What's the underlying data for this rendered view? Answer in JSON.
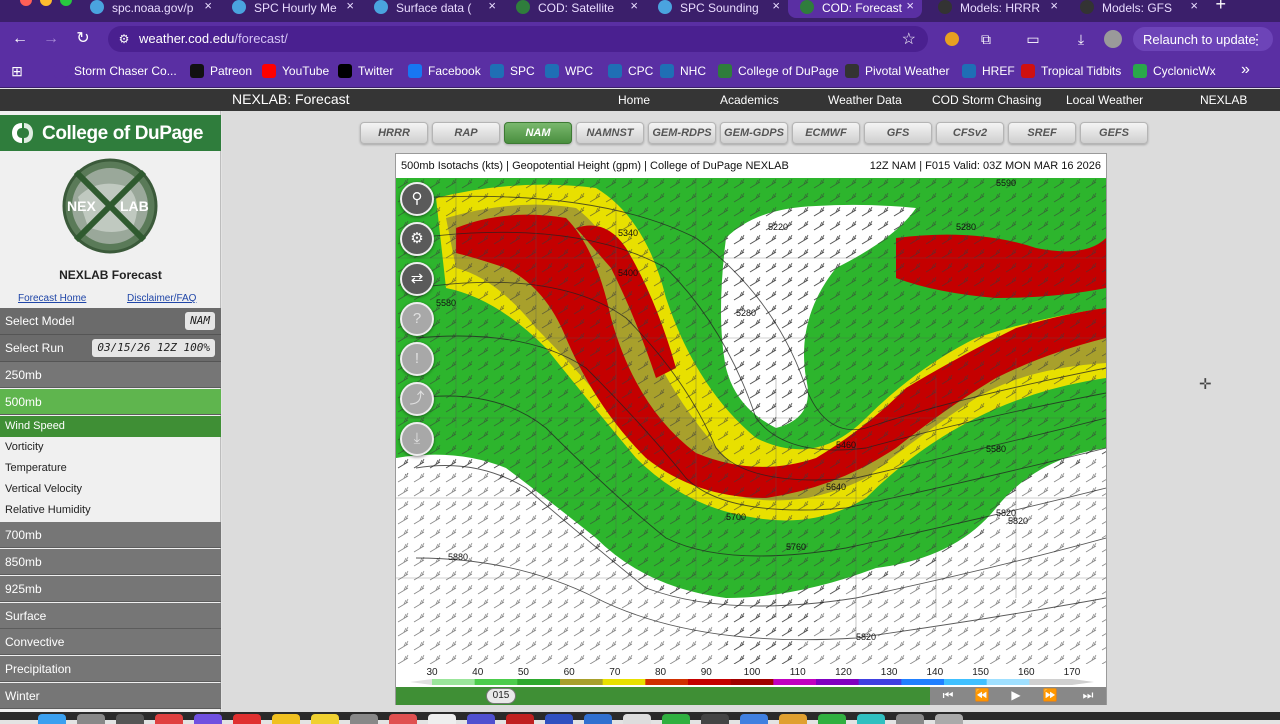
{
  "browser": {
    "tabs": [
      {
        "title": "spc.noaa.gov/p",
        "active": false
      },
      {
        "title": "SPC Hourly Me",
        "active": false
      },
      {
        "title": "Surface data (",
        "active": false
      },
      {
        "title": "COD: Satellite",
        "active": false
      },
      {
        "title": "SPC Sounding",
        "active": false
      },
      {
        "title": "COD: Forecast",
        "active": true
      },
      {
        "title": "Models: HRRR",
        "active": false
      },
      {
        "title": "Models: GFS",
        "active": false
      }
    ],
    "new_tab_symbol": "+",
    "url_host": "weather.cod.edu",
    "url_path": "/forecast/",
    "relaunch_label": "Relaunch to update",
    "bookmarks": [
      {
        "label": "Storm Chaser Co...",
        "icon": "folder-icon",
        "color": "#5a2fa3"
      },
      {
        "label": "Patreon",
        "icon": "patreon-icon",
        "color": "#111111"
      },
      {
        "label": "YouTube",
        "icon": "youtube-icon",
        "color": "#ff0000"
      },
      {
        "label": "Twitter",
        "icon": "x-icon",
        "color": "#000000"
      },
      {
        "label": "Facebook",
        "icon": "facebook-icon",
        "color": "#1877f2"
      },
      {
        "label": "SPC",
        "icon": "noaa-icon",
        "color": "#1f6fb5"
      },
      {
        "label": "WPC",
        "icon": "noaa-icon",
        "color": "#1f6fb5"
      },
      {
        "label": "CPC",
        "icon": "noaa-icon",
        "color": "#1f6fb5"
      },
      {
        "label": "NHC",
        "icon": "noaa-icon",
        "color": "#1f6fb5"
      },
      {
        "label": "College of DuPage",
        "icon": "cod-icon",
        "color": "#2f7d3c"
      },
      {
        "label": "Pivotal Weather",
        "icon": "pivotal-icon",
        "color": "#333333"
      },
      {
        "label": "HREF",
        "icon": "noaa-icon",
        "color": "#1f6fb5"
      },
      {
        "label": "Tropical Tidbits",
        "icon": "tropical-icon",
        "color": "#d01010"
      },
      {
        "label": "CyclonicWx",
        "icon": "cyclonic-icon",
        "color": "#2aa84a"
      }
    ],
    "more_bookmarks_symbol": "»"
  },
  "site": {
    "title": "NEXLAB: Forecast",
    "nav": [
      "Home",
      "Academics",
      "Weather Data",
      "COD Storm Chasing",
      "Local Weather",
      "NEXLAB"
    ]
  },
  "sidebar": {
    "college_name": "College of DuPage",
    "nexlab_logo_text": [
      "NEX",
      "LAB"
    ],
    "forecast_title": "NEXLAB Forecast",
    "links": [
      "Forecast Home",
      "Disclaimer/FAQ"
    ],
    "select_model": {
      "label": "Select Model",
      "value": "NAM"
    },
    "select_run": {
      "label": "Select Run",
      "value": "03/15/26 12Z 100%"
    },
    "levels_top": [
      {
        "label": "250mb",
        "active": false
      },
      {
        "label": "500mb",
        "active": true
      }
    ],
    "fields": [
      {
        "label": "Wind Speed",
        "active": true
      },
      {
        "label": "Vorticity",
        "active": false
      },
      {
        "label": "Temperature",
        "active": false
      },
      {
        "label": "Vertical Velocity",
        "active": false
      },
      {
        "label": "Relative Humidity",
        "active": false
      }
    ],
    "levels_bottom": [
      "700mb",
      "850mb",
      "925mb",
      "Surface",
      "Convective",
      "Precipitation",
      "Winter"
    ]
  },
  "models": [
    {
      "label": "HRRR",
      "active": false
    },
    {
      "label": "RAP",
      "active": false
    },
    {
      "label": "NAM",
      "active": true
    },
    {
      "label": "NAMNST",
      "active": false
    },
    {
      "label": "GEM-RDPS",
      "active": false
    },
    {
      "label": "GEM-GDPS",
      "active": false
    },
    {
      "label": "ECMWF",
      "active": false
    },
    {
      "label": "GFS",
      "active": false
    },
    {
      "label": "CFSv2",
      "active": false
    },
    {
      "label": "SREF",
      "active": false
    },
    {
      "label": "GEFS",
      "active": false
    }
  ],
  "map": {
    "title": "500mb Isotachs (kts) | Geopotential Height (gpm) | College of DuPage NEXLAB",
    "valid": "12Z NAM | F015 Valid: 03Z MON MAR 16 2026",
    "tools": [
      "user-location-icon",
      "settings-icon",
      "swap-icon",
      "help-icon",
      "alert-icon",
      "share-icon",
      "download-icon"
    ],
    "height_labels": [
      "5340",
      "5400",
      "5220",
      "5280",
      "5280",
      "5460",
      "5580",
      "5640",
      "5700",
      "5760",
      "5820",
      "5880",
      "5820",
      "5820",
      "5580",
      "5590"
    ],
    "colors": {
      "low": "#2db52d",
      "mid": "#e8e000",
      "olive": "#a8a02c",
      "high": "#c40000"
    }
  },
  "colorbar": {
    "ticks": [
      "30",
      "40",
      "50",
      "60",
      "70",
      "80",
      "90",
      "100",
      "110",
      "120",
      "130",
      "140",
      "150",
      "160",
      "170"
    ],
    "colors": [
      "#9be59b",
      "#4ccc4c",
      "#2ea82e",
      "#a8a02c",
      "#e8e000",
      "#d03000",
      "#c40000",
      "#a00000",
      "#c000c0",
      "#8000c0",
      "#4040e0",
      "#2080ff",
      "#40c0ff",
      "#a0e0ff",
      "#d0d0d0"
    ]
  },
  "timeline": {
    "frame": "015",
    "controls": [
      "first-frame-icon",
      "step-back-icon",
      "play-icon",
      "step-forward-icon",
      "last-frame-icon"
    ]
  }
}
